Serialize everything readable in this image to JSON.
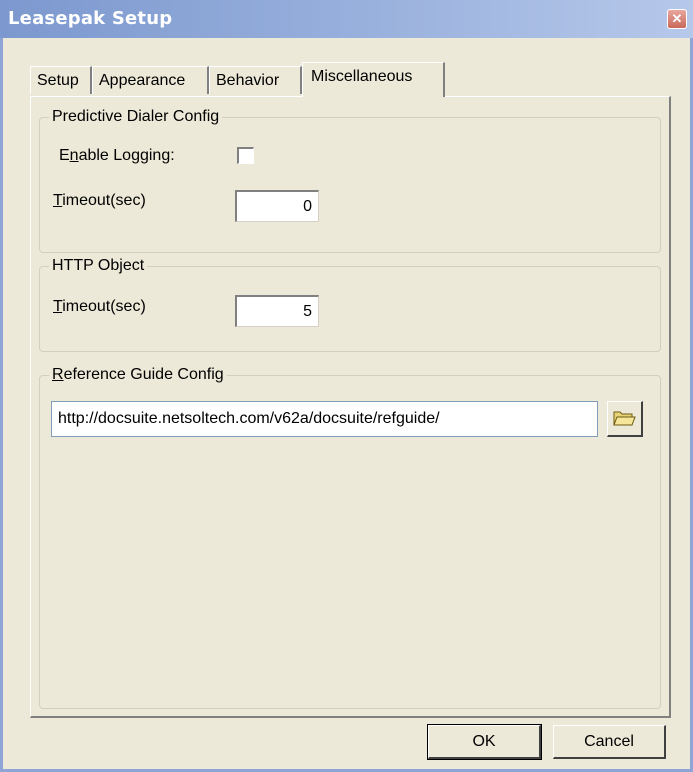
{
  "window": {
    "title": "Leasepak Setup",
    "close_glyph": "✕"
  },
  "tabs": [
    {
      "label": "Setup"
    },
    {
      "label": "Appearance"
    },
    {
      "label": "Behavior"
    },
    {
      "label": "Miscellaneous",
      "active": true
    }
  ],
  "predictive_dialer": {
    "title": "Predictive Dialer Config",
    "enable_logging": {
      "label_pre": "E",
      "label_ul": "n",
      "label_post": "able Logging:",
      "checked": false
    },
    "timeout": {
      "label_ul": "T",
      "label_post": "imeout(sec)",
      "value": "0"
    }
  },
  "http_object": {
    "title": "HTTP Object",
    "timeout": {
      "label_ul": "T",
      "label_post": "imeout(sec)",
      "value": "5"
    }
  },
  "reference_guide": {
    "title_ul": "R",
    "title_post": "eference Guide Config",
    "url": "http://docsuite.netsoltech.com/v62a/docsuite/refguide/",
    "browse_icon": "folder-icon"
  },
  "buttons": {
    "ok": "OK",
    "cancel": "Cancel"
  }
}
